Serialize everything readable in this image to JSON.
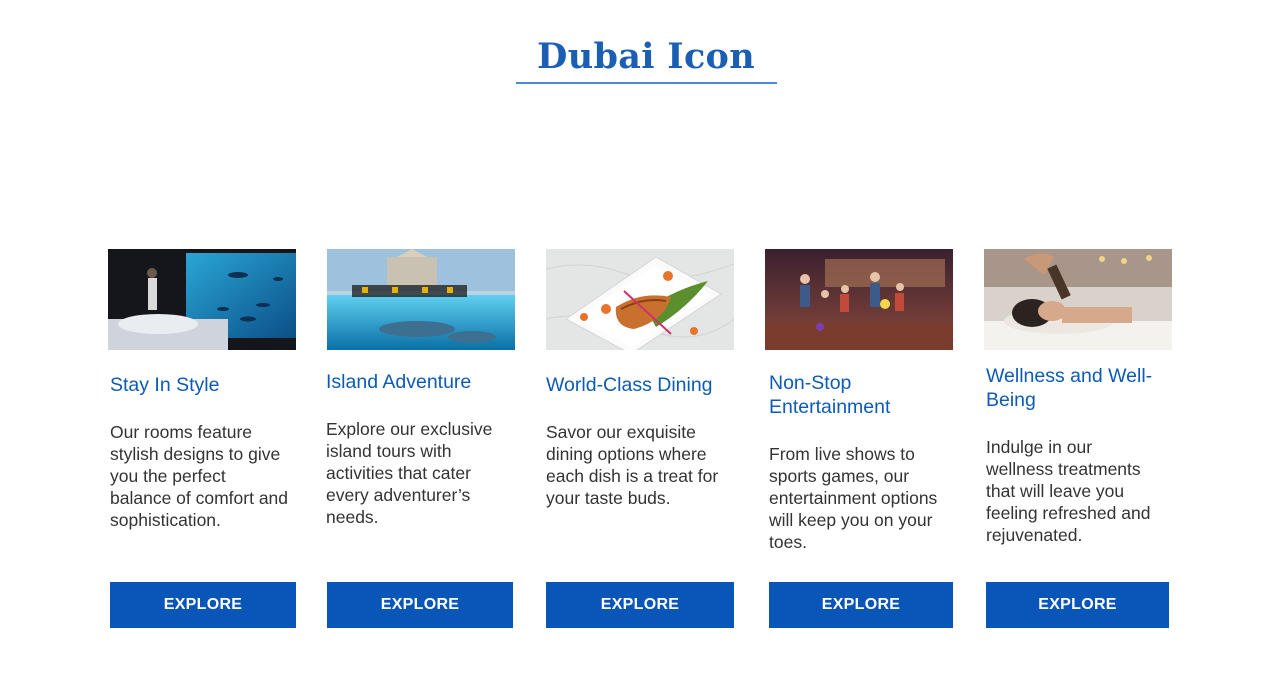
{
  "page": {
    "title": "Dubai Icon"
  },
  "colors": {
    "accent": "#0a56b8",
    "title": "#1a5fb4",
    "body_text": "#333333"
  },
  "cards": [
    {
      "title": "Stay In Style",
      "text": "Our rooms feature stylish designs to give you the perfect balance of comfort and sophistication.",
      "button": "EXPLORE",
      "image": "underwater-suite-photo"
    },
    {
      "title": "Island Adventure",
      "text": "Explore our exclusive island tours with activities that cater every adventurer’s needs.",
      "button": "EXPLORE",
      "image": "dolphin-encounter-photo"
    },
    {
      "title": "World-Class Dining",
      "text": "Savor our exquisite dining options where each dish is a treat for your taste buds.",
      "button": "EXPLORE",
      "image": "plated-fish-dish-photo"
    },
    {
      "title": "Non-Stop Entertainment",
      "text": "From live shows to sports games, our entertainment options will keep you on your toes.",
      "button": "EXPLORE",
      "image": "family-bowling-photo"
    },
    {
      "title": "Wellness and Well-Being",
      "text": "Indulge in our wellness treatments that will leave you feeling refreshed and rejuvenated.",
      "button": "EXPLORE",
      "image": "spa-treatment-photo"
    }
  ]
}
